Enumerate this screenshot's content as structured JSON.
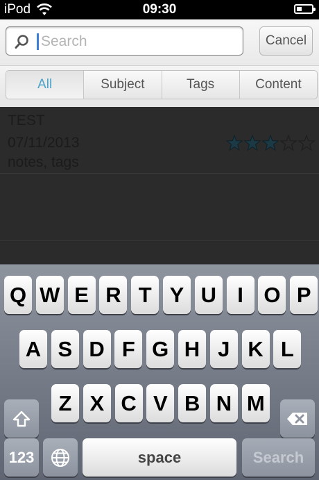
{
  "status_bar": {
    "carrier": "iPod",
    "time": "09:30",
    "battery_level": 0.35
  },
  "search": {
    "placeholder": "Search",
    "value": "",
    "cancel_label": "Cancel"
  },
  "scope_bar": {
    "segments": [
      {
        "label": "All",
        "selected": true
      },
      {
        "label": "Subject",
        "selected": false
      },
      {
        "label": "Tags",
        "selected": false
      },
      {
        "label": "Content",
        "selected": false
      }
    ]
  },
  "results": [
    {
      "title": "TEST",
      "date": "07/11/2013",
      "tags": "notes, tags",
      "rating": 3,
      "rating_max": 5
    }
  ],
  "keyboard": {
    "row1": [
      "Q",
      "W",
      "E",
      "R",
      "T",
      "Y",
      "U",
      "I",
      "O",
      "P"
    ],
    "row2": [
      "A",
      "S",
      "D",
      "F",
      "G",
      "H",
      "J",
      "K",
      "L"
    ],
    "row3": [
      "Z",
      "X",
      "C",
      "V",
      "B",
      "N",
      "M"
    ],
    "numbers_label": "123",
    "space_label": "space",
    "search_label": "Search"
  },
  "colors": {
    "accent": "#4aa3c8",
    "list_background": "#2b2b2b",
    "star_filled": "#1c3a45"
  },
  "icons": [
    "wifi-icon",
    "battery-icon",
    "search-icon",
    "star-icon",
    "shift-icon",
    "backspace-icon",
    "globe-icon"
  ]
}
